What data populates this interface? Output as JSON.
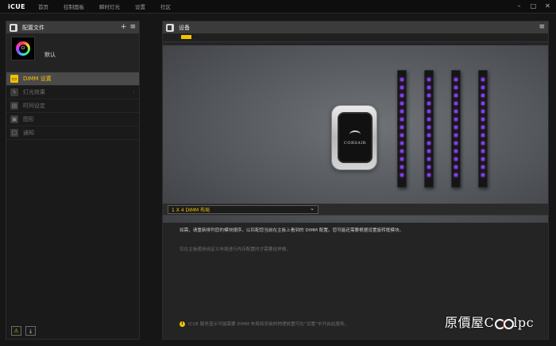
{
  "app": {
    "logo": "iCUE",
    "nav": [
      "首页",
      "控制面板",
      "瞬时灯光",
      "设置",
      "社区"
    ],
    "window_controls": [
      "–",
      "□",
      "✕"
    ]
  },
  "profiles": {
    "title": "配置文件",
    "add_icon": "+",
    "menu_icon": "≡",
    "current": "默认"
  },
  "sidebar": {
    "items": [
      {
        "label": "DIMM 设置",
        "active": true,
        "icon": "dimm-icon"
      },
      {
        "label": "灯光效果",
        "active": false,
        "icon": "lightning-icon"
      },
      {
        "label": "时间设定",
        "active": false,
        "icon": "keyboard-icon"
      },
      {
        "label": "图形",
        "active": false,
        "icon": "graph-icon"
      },
      {
        "label": "通知",
        "active": false,
        "icon": "notification-icon"
      }
    ]
  },
  "footer": {
    "warning_icon": "⚠",
    "download_icon": "⤓"
  },
  "device_panel": {
    "title": "设备",
    "menu_icon": "≡",
    "pump_brand": "CORSAIR",
    "dimm_led_color": "#8a3cff",
    "layout_select": "1 X 4 DIMM 布局",
    "description": "如需，请重新排列您的模块顺序，以匹配您当前在主板上看到的 DIMM 配置。您可能还需要根据设置旋转框模块。",
    "sub_description": "仅在主板使用自定义布局进行内存配置时才需要这样做。",
    "notice": "iCUE 服务显示可能需要 DIMM 布局和安装的物理放置可在“设置”中开启此服务。"
  },
  "colors": {
    "accent": "#f2c200",
    "background": "#161616",
    "panel": "#242424"
  },
  "watermark": {
    "prefix": "原價屋C",
    "suffix": "lpc"
  }
}
